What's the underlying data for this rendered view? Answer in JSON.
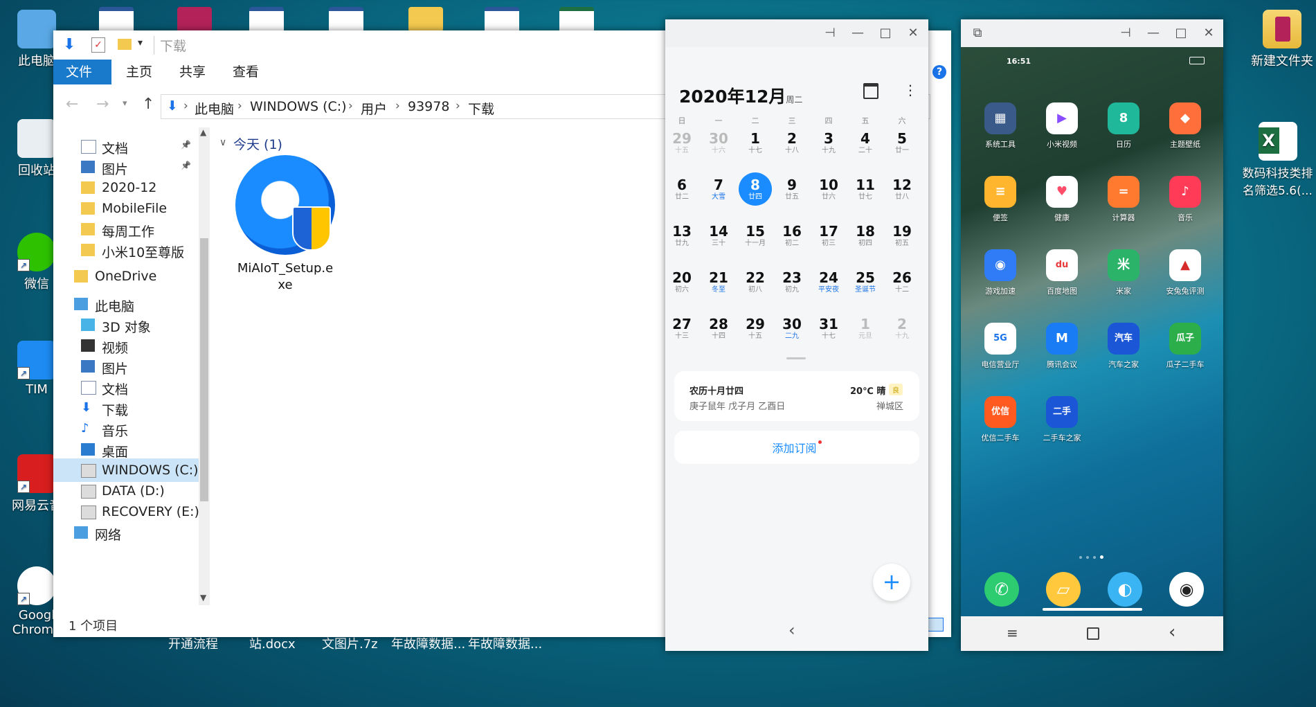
{
  "desktop": {
    "left_icons": [
      {
        "name": "computer-icon",
        "label": "此电脑"
      },
      {
        "name": "recycle-bin-icon",
        "label": "回收站"
      },
      {
        "name": "wechat-icon",
        "label": "微信"
      },
      {
        "name": "tim-icon",
        "label": "TIM"
      },
      {
        "name": "netease-music-icon",
        "label": "网易云音"
      },
      {
        "name": "chrome-icon",
        "label": "Googl Chrome"
      }
    ],
    "right_icons": [
      {
        "name": "folder-icon",
        "label": "新建文件夹"
      },
      {
        "name": "excel-icon",
        "label": "数码科技类排名筛选5.6(..."
      }
    ],
    "bottom_labels": [
      "开通流程",
      "站.docx",
      "文图片.7z",
      "年故障数据...",
      "年故障数据..."
    ]
  },
  "explorer": {
    "title": "下载",
    "tabs": [
      "文件",
      "主页",
      "共享",
      "查看"
    ],
    "breadcrumb": [
      "此电脑",
      "WINDOWS (C:)",
      "用户",
      "93978",
      "下载"
    ],
    "nav": [
      {
        "label": "文档",
        "icon": "document-icon",
        "pinned": true
      },
      {
        "label": "图片",
        "icon": "picture-icon",
        "pinned": true
      },
      {
        "label": "2020-12",
        "icon": "folder-icon"
      },
      {
        "label": "MobileFile",
        "icon": "folder-icon"
      },
      {
        "label": "每周工作",
        "icon": "folder-icon"
      },
      {
        "label": "小米10至尊版",
        "icon": "folder-icon"
      },
      {
        "label": "OneDrive",
        "icon": "folder-icon"
      },
      {
        "label": "此电脑",
        "icon": "computer-icon"
      },
      {
        "label": "3D 对象",
        "icon": "cube-icon"
      },
      {
        "label": "视频",
        "icon": "video-icon"
      },
      {
        "label": "图片",
        "icon": "picture-icon"
      },
      {
        "label": "文档",
        "icon": "document-icon"
      },
      {
        "label": "下载",
        "icon": "download-icon"
      },
      {
        "label": "音乐",
        "icon": "music-icon"
      },
      {
        "label": "桌面",
        "icon": "desktop-icon"
      },
      {
        "label": "WINDOWS (C:)",
        "icon": "drive-icon",
        "selected": true
      },
      {
        "label": "DATA (D:)",
        "icon": "drive-icon"
      },
      {
        "label": "RECOVERY (E:)",
        "icon": "drive-icon"
      },
      {
        "label": "网络",
        "icon": "network-icon"
      }
    ],
    "group_header": "今天 (1)",
    "files": [
      {
        "name": "MiAIoT_Setup.exe"
      }
    ],
    "status": "1 个项目"
  },
  "calendar": {
    "month_title": "2020年12月",
    "weekday_of_title": "周二",
    "weekdays": [
      "日",
      "一",
      "二",
      "三",
      "四",
      "五",
      "六"
    ],
    "weeks": [
      [
        {
          "n": "29",
          "l": "十五",
          "dim": true
        },
        {
          "n": "30",
          "l": "十六",
          "dim": true
        },
        {
          "n": "1",
          "l": "十七"
        },
        {
          "n": "2",
          "l": "十八"
        },
        {
          "n": "3",
          "l": "十九"
        },
        {
          "n": "4",
          "l": "二十"
        },
        {
          "n": "5",
          "l": "廿一"
        }
      ],
      [
        {
          "n": "6",
          "l": "廿二"
        },
        {
          "n": "7",
          "l": "大雪",
          "hol": true
        },
        {
          "n": "8",
          "l": "廿四",
          "today": true
        },
        {
          "n": "9",
          "l": "廿五"
        },
        {
          "n": "10",
          "l": "廿六"
        },
        {
          "n": "11",
          "l": "廿七"
        },
        {
          "n": "12",
          "l": "廿八"
        }
      ],
      [
        {
          "n": "13",
          "l": "廿九"
        },
        {
          "n": "14",
          "l": "三十"
        },
        {
          "n": "15",
          "l": "十一月"
        },
        {
          "n": "16",
          "l": "初二"
        },
        {
          "n": "17",
          "l": "初三"
        },
        {
          "n": "18",
          "l": "初四"
        },
        {
          "n": "19",
          "l": "初五"
        }
      ],
      [
        {
          "n": "20",
          "l": "初六"
        },
        {
          "n": "21",
          "l": "冬至",
          "hol": true
        },
        {
          "n": "22",
          "l": "初八"
        },
        {
          "n": "23",
          "l": "初九"
        },
        {
          "n": "24",
          "l": "平安夜",
          "hol": true
        },
        {
          "n": "25",
          "l": "圣诞节",
          "hol": true
        },
        {
          "n": "26",
          "l": "十二"
        }
      ],
      [
        {
          "n": "27",
          "l": "十三"
        },
        {
          "n": "28",
          "l": "十四"
        },
        {
          "n": "29",
          "l": "十五"
        },
        {
          "n": "30",
          "l": "二九",
          "hol": true
        },
        {
          "n": "31",
          "l": "十七"
        },
        {
          "n": "1",
          "l": "元旦",
          "dim": true
        },
        {
          "n": "2",
          "l": "十九",
          "dim": true
        }
      ]
    ],
    "lunar_title": "农历十月廿四",
    "lunar_sub": "庚子鼠年 戊子月 乙酉日",
    "weather": "20℃ 晴",
    "weather_badge": "良",
    "district": "禅城区",
    "subscribe": "添加订阅",
    "fab": "+"
  },
  "phone": {
    "time": "16:51",
    "apps": [
      {
        "label": "系统工具",
        "color": "#3a5a8a",
        "glyph": "▦"
      },
      {
        "label": "小米视频",
        "color": "#ffffff",
        "glyph": "▶",
        "fg": "#8a4dff"
      },
      {
        "label": "日历",
        "color": "#1fb89a",
        "glyph": "8"
      },
      {
        "label": "主题壁纸",
        "color": "#ff6f3c",
        "glyph": "◆"
      },
      {
        "label": "便签",
        "color": "#ffb62e",
        "glyph": "≡"
      },
      {
        "label": "健康",
        "color": "#ffffff",
        "glyph": "♥",
        "fg": "#ff4d6a"
      },
      {
        "label": "计算器",
        "color": "#ff7a2f",
        "glyph": "="
      },
      {
        "label": "音乐",
        "color": "#ff3b57",
        "glyph": "♪"
      },
      {
        "label": "游戏加速",
        "color": "#2f7cf6",
        "glyph": "◉"
      },
      {
        "label": "百度地图",
        "color": "#ffffff",
        "glyph": "du",
        "fg": "#e83a3a"
      },
      {
        "label": "米家",
        "color": "#2cb36a",
        "glyph": "米"
      },
      {
        "label": "安兔兔评测",
        "color": "#ffffff",
        "glyph": "▲",
        "fg": "#d62b2b"
      },
      {
        "label": "电信营业厅",
        "color": "#ffffff",
        "glyph": "5G",
        "fg": "#1a73e8"
      },
      {
        "label": "腾讯会议",
        "color": "#1a7cf5",
        "glyph": "M"
      },
      {
        "label": "汽车之家",
        "color": "#1a56d6",
        "glyph": "汽车"
      },
      {
        "label": "瓜子二手车",
        "color": "#2cae4b",
        "glyph": "瓜子"
      },
      {
        "label": "优信二手车",
        "color": "#ff5a1f",
        "glyph": "优信"
      },
      {
        "label": "二手车之家",
        "color": "#1a56d6",
        "glyph": "二手"
      }
    ],
    "dock": [
      {
        "name": "phone-call-icon",
        "color": "#2ecc71",
        "glyph": "✆"
      },
      {
        "name": "messages-icon",
        "color": "#ffc83d",
        "glyph": "▱"
      },
      {
        "name": "browser-icon",
        "color": "#3ab4f2",
        "glyph": "◐"
      },
      {
        "name": "camera-icon",
        "color": "#ffffff",
        "glyph": "◉"
      }
    ]
  }
}
